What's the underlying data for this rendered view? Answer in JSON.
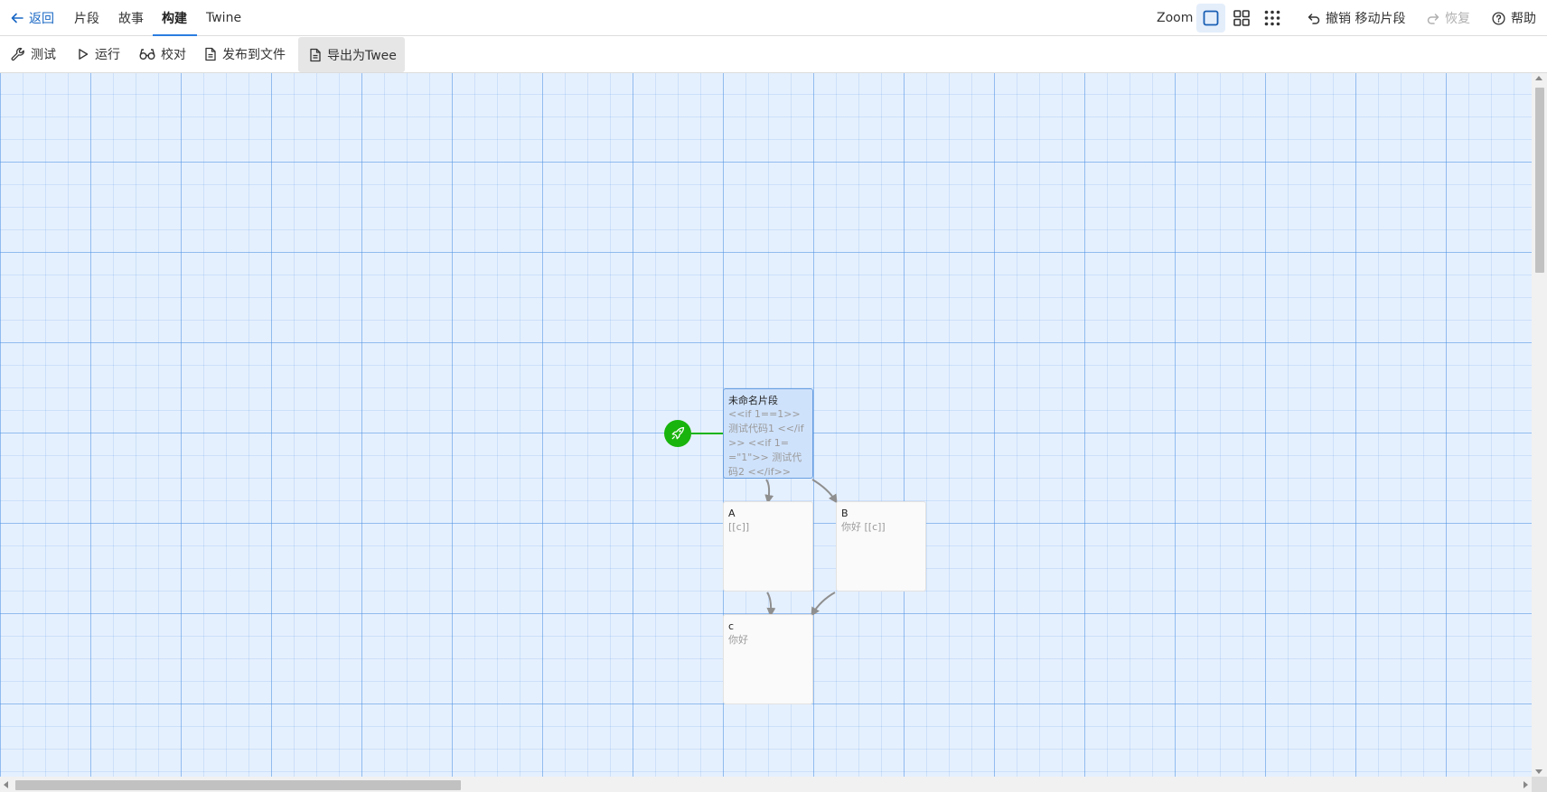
{
  "nav": {
    "back": "返回",
    "tabs": [
      {
        "label": "片段"
      },
      {
        "label": "故事"
      },
      {
        "label": "构建",
        "active": true
      },
      {
        "label": "Twine"
      }
    ],
    "zoom_label": "Zoom",
    "zoom_options": [
      {
        "icon": "zoom-large-square-icon",
        "selected": true
      },
      {
        "icon": "zoom-medium-grid-icon",
        "selected": false
      },
      {
        "icon": "zoom-small-dots-icon",
        "selected": false
      }
    ],
    "undo": "撤销 移动片段",
    "redo": "恢复",
    "help": "帮助"
  },
  "toolbar": {
    "test": "测试",
    "play": "运行",
    "proof": "校对",
    "publish": "发布到文件",
    "export_twee": "导出为Twee"
  },
  "passages": [
    {
      "id": "start",
      "title": "未命名片段",
      "excerpt": "<<if 1==1>> 测试代码1 <</if>> <<if 1==\"1\">> 测试代码2 <</if>>",
      "selected": true,
      "start": true
    },
    {
      "id": "a",
      "title": "A",
      "excerpt": "[[c]]",
      "selected": false
    },
    {
      "id": "b",
      "title": "B",
      "excerpt": "你好 [[c]]",
      "selected": false
    },
    {
      "id": "c",
      "title": "c",
      "excerpt": "你好",
      "selected": false
    }
  ],
  "colors": {
    "accent": "#2b7de0",
    "canvas_bg": "#e5f0fe",
    "selected_passage": "#cfe2fb",
    "start_badge": "#19b40d",
    "connector": "#8f8f8f"
  }
}
